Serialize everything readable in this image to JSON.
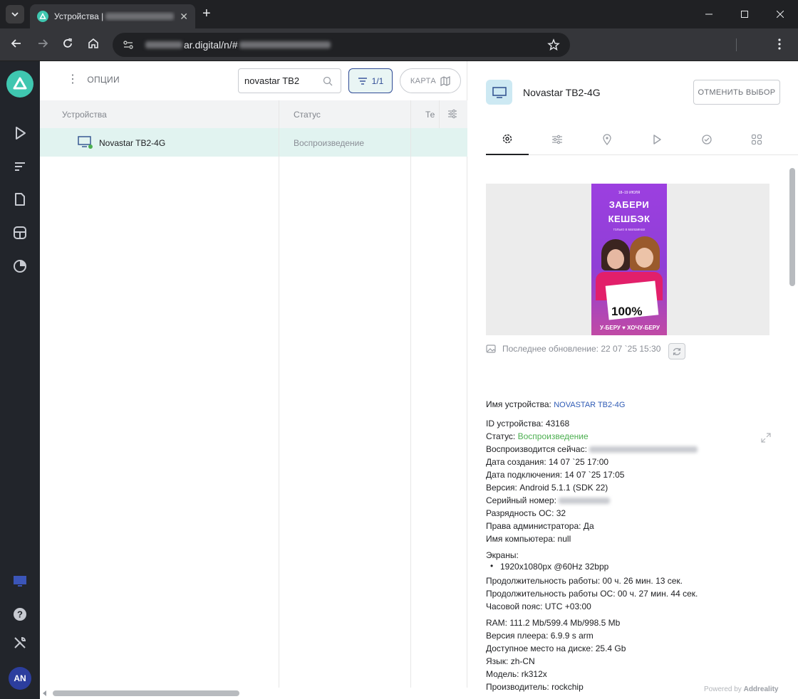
{
  "browser": {
    "tab_title": "Устройства |",
    "url_suffix": "ar.digital/n/#"
  },
  "list": {
    "options_label": "ОПЦИИ",
    "search_value": "novastar TB2",
    "filter_label": "1/1",
    "map_label": "КАРТА",
    "columns": [
      "Устройства",
      "Статус",
      "Те"
    ],
    "rows": [
      {
        "name": "Novastar TB2-4G",
        "status": "Воспроизведение"
      }
    ]
  },
  "detail": {
    "title": "Novastar TB2-4G",
    "deselect_label": "ОТМЕНИТЬ ВЫБОР",
    "tabs": [
      "settings-icon",
      "sliders-icon",
      "location-icon",
      "play-icon",
      "check-icon",
      "grid-icon"
    ],
    "poster": {
      "date": "18–19 ИЮЛЯ",
      "line1": "ЗАБЕРИ",
      "line2": "КЕШБЭК",
      "sub": "только в магазинах",
      "big": "100%",
      "bottom": "У-БЕРУ ♥ ХОЧУ-БЕРУ"
    },
    "last_update": "Последнее обновление: 22 07 `25 15:30",
    "device_name_label": "Имя устройства:",
    "device_name_value": "NOVASTAR TB2-4G",
    "id": "ID устройства: 43168",
    "status_label": "Статус:",
    "status_value": "Воспроизведение",
    "playing_now_label": "Воспроизводится сейчас:",
    "created": "Дата создания: 14 07 `25 17:00",
    "connected": "Дата подключения: 14 07 `25 17:05",
    "version": "Версия: Android 5.1.1 (SDK 22)",
    "serial_label": "Серийный номер:",
    "os_bits": "Разрядность ОС: 32",
    "admin": "Права администратора: Да",
    "computer": "Имя компьютера: null",
    "screens_label": "Экраны:",
    "screen_1": "1920x1080px @60Hz 32bpp",
    "uptime": "Продолжительность работы: 00 ч. 26 мин. 13 сек.",
    "os_uptime": "Продолжительность работы ОС: 00 ч. 27 мин. 44 сек.",
    "timezone": "Часовой пояс: UTC +03:00",
    "ram": "RAM: 111.2 Mb/599.4 Mb/998.5 Mb",
    "player": "Версия плеера: 6.9.9 s arm",
    "disk": "Доступное место на диске: 25.4 Gb",
    "lang": "Язык: zh-CN",
    "model": "Модель: rk312x",
    "maker": "Производитель: rockchip",
    "powered_prefix": "Powered by",
    "powered_brand": "Addreality"
  },
  "user": {
    "initials": "AN"
  },
  "colors": {
    "accent": "#3fc7b0",
    "nav_bg": "#22252b",
    "selected_row": "#e1f3f0",
    "status_green": "#4caf50"
  }
}
